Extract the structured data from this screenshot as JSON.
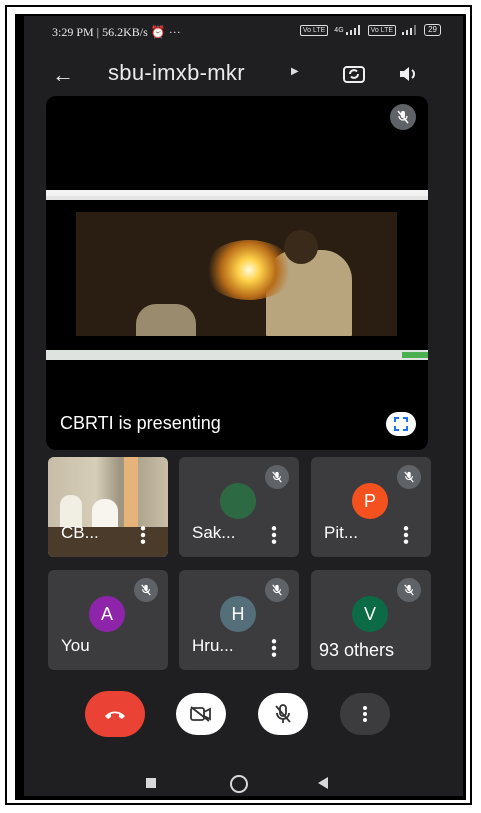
{
  "status_bar": {
    "time": "3:29 PM | 56.2KB/s ⏰  ···",
    "volte1": "Vo LTE",
    "network": "4G",
    "volte2": "Vo LTE",
    "battery": "29"
  },
  "header": {
    "back_icon": "arrow-left-icon",
    "meeting_code": "sbu-imxb-mkr",
    "switch_camera_icon": "camera-switch-icon",
    "audio_icon": "speaker-icon"
  },
  "presentation": {
    "label": "CBRTI is presenting",
    "mute_icon": "mic-off-icon",
    "fullscreen_icon": "fullscreen-icon"
  },
  "participants": [
    {
      "name": "CB...",
      "avatar": "",
      "color": "#8a7d6c",
      "muted": false,
      "camera": true
    },
    {
      "name": "Sak...",
      "avatar": "",
      "color": "#2d6a43",
      "muted": true,
      "camera": false
    },
    {
      "name": "Pit...",
      "avatar": "P",
      "color": "#f4511e",
      "muted": true,
      "camera": false
    },
    {
      "name": "You",
      "avatar": "A",
      "color": "#8e24aa",
      "muted": true,
      "camera": false
    },
    {
      "name": "Hru...",
      "avatar": "H",
      "color": "#546e7a",
      "muted": true,
      "camera": false
    },
    {
      "name": "93 others",
      "avatar": "V",
      "color": "#0b6b46",
      "muted": true,
      "camera": false
    }
  ],
  "controls": {
    "end_call_icon": "phone-hangup-icon",
    "camera_icon": "video-off-icon",
    "mic_icon": "mic-off-icon",
    "more_icon": "more-vertical-icon",
    "end_call_color": "#ea4335"
  },
  "nav_bar": {
    "recents_icon": "square-icon",
    "home_icon": "circle-icon",
    "back_icon": "triangle-back-icon"
  }
}
